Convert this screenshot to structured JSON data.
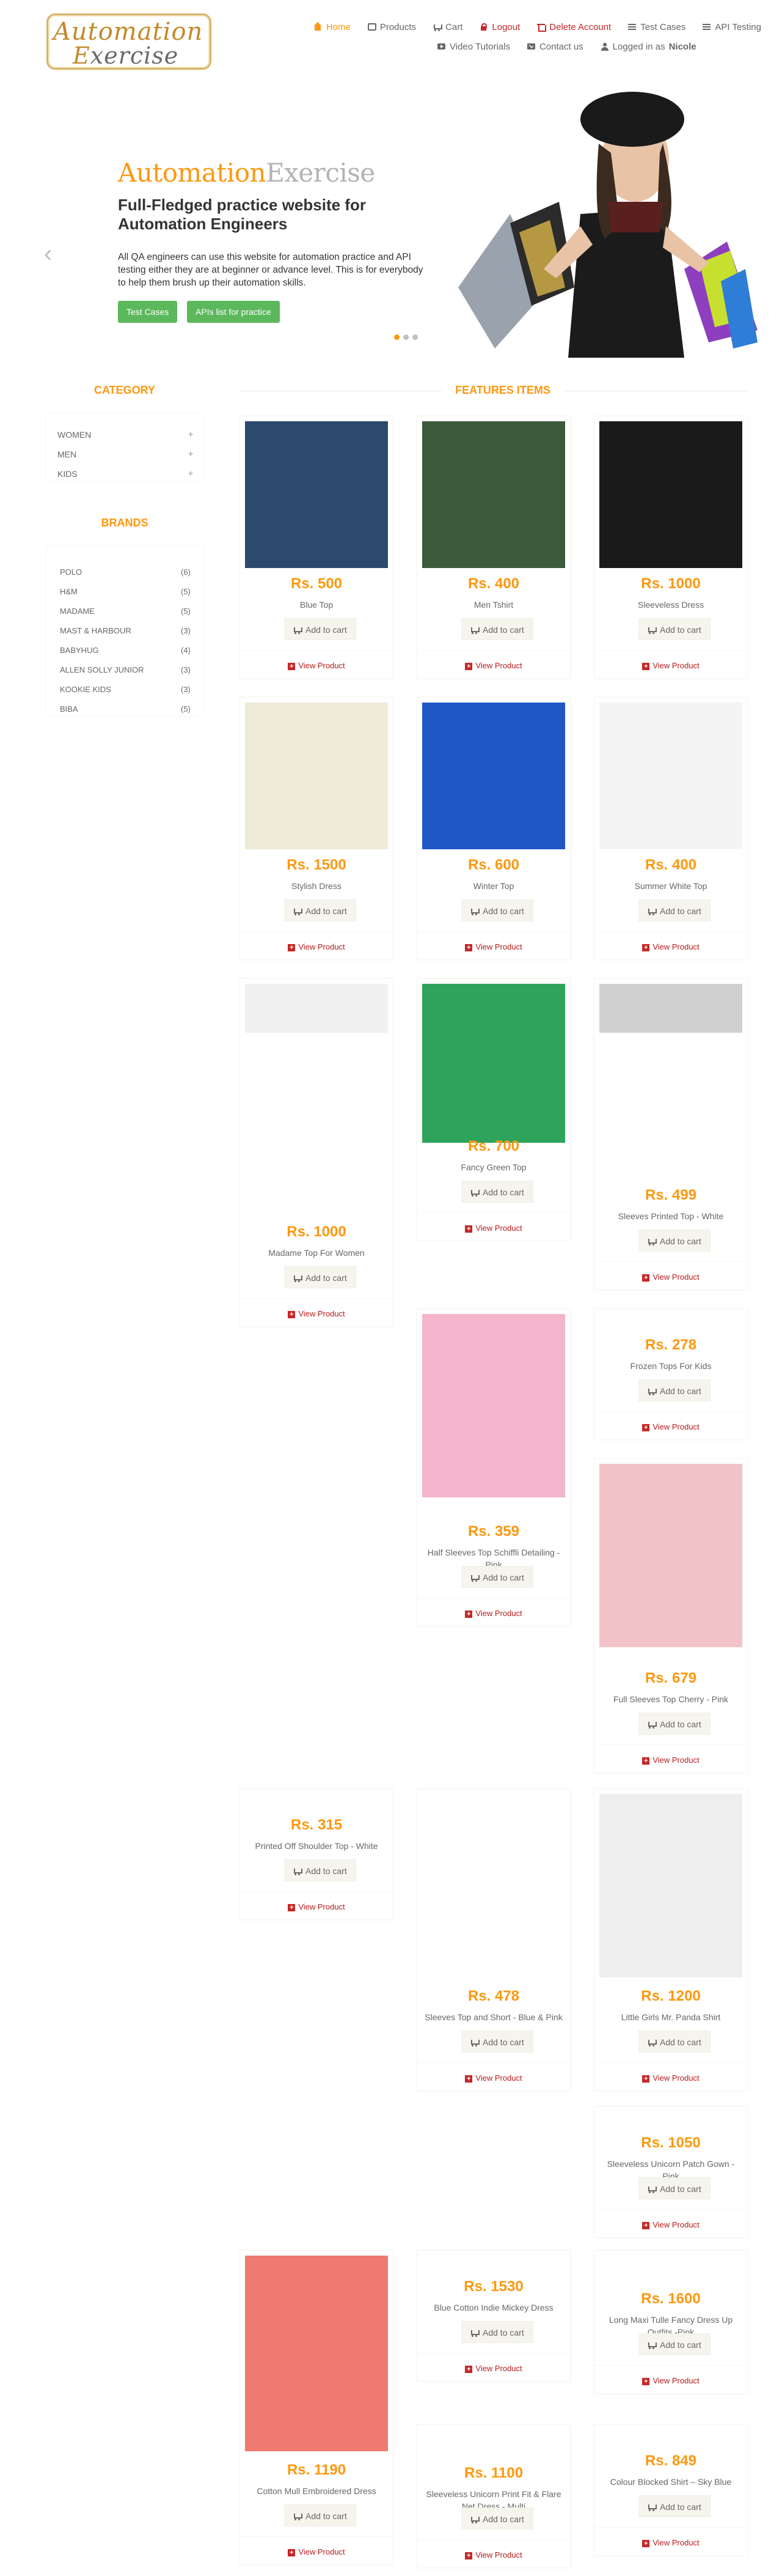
{
  "logo": {
    "line1": "Automation",
    "line2_first": "E",
    "line2_rest": "xercise"
  },
  "nav": {
    "home": "Home",
    "products": "Products",
    "cart": "Cart",
    "logout": "Logout",
    "delete_account": "Delete Account",
    "test_cases": "Test Cases",
    "api_testing": "API Testing",
    "video_tutorials": "Video Tutorials",
    "contact_us": "Contact us",
    "logged_in_prefix": "Logged in as",
    "username": "Nicole"
  },
  "hero": {
    "title_a": "Automation",
    "title_b": "Exercise",
    "subtitle": "Full-Fledged practice website for Automation Engineers",
    "description": "All QA engineers can use this website for automation practice and API testing either they are at beginner or advance level. This is for everybody to help them brush up their automation skills.",
    "btn_test_cases": "Test Cases",
    "btn_apis": "APIs list for practice",
    "prev": "‹",
    "next": "›"
  },
  "category": {
    "title": "Category",
    "items": [
      "Women",
      "Men",
      "Kids"
    ]
  },
  "brands": {
    "title": "Brands",
    "items": [
      {
        "name": "Polo",
        "count": "(6)"
      },
      {
        "name": "H&M",
        "count": "(5)"
      },
      {
        "name": "Madame",
        "count": "(5)"
      },
      {
        "name": "Mast & Harbour",
        "count": "(3)"
      },
      {
        "name": "Babyhug",
        "count": "(4)"
      },
      {
        "name": "Allen Solly Junior",
        "count": "(3)"
      },
      {
        "name": "Kookie Kids",
        "count": "(3)"
      },
      {
        "name": "Biba",
        "count": "(5)"
      }
    ]
  },
  "features": {
    "title": "Features Items",
    "add_to_cart": "Add to cart",
    "view_product": "View Product"
  },
  "products": [
    {
      "price": "Rs. 500",
      "name": "Blue Top"
    },
    {
      "price": "Rs. 400",
      "name": "Men Tshirt"
    },
    {
      "price": "Rs. 1000",
      "name": "Sleeveless Dress"
    },
    {
      "price": "Rs. 1500",
      "name": "Stylish Dress"
    },
    {
      "price": "Rs. 600",
      "name": "Winter Top"
    },
    {
      "price": "Rs. 400",
      "name": "Summer White Top"
    },
    {
      "price": "Rs. 1000",
      "name": "Madame Top For Women"
    },
    {
      "price": "Rs. 700",
      "name": "Fancy Green Top"
    },
    {
      "price": "Rs. 499",
      "name": "Sleeves Printed Top - White"
    },
    {
      "price": "Rs. 359",
      "name": "Half Sleeves Top Schiffli Detailing - Pink"
    },
    {
      "price": "Rs. 278",
      "name": "Frozen Tops For Kids"
    },
    {
      "price": "Rs. 679",
      "name": "Full Sleeves Top Cherry - Pink"
    },
    {
      "price": "Rs. 315",
      "name": "Printed Off Shoulder Top - White"
    },
    {
      "price": "Rs. 478",
      "name": "Sleeves Top and Short - Blue & Pink"
    },
    {
      "price": "Rs. 1200",
      "name": "Little Girls Mr. Panda Shirt"
    },
    {
      "price": "Rs. 1050",
      "name": "Sleeveless Unicorn Patch Gown - Pink"
    },
    {
      "price": "Rs. 1190",
      "name": "Cotton Mull Embroidered Dress"
    },
    {
      "price": "Rs. 1530",
      "name": "Blue Cotton Indie Mickey Dress"
    },
    {
      "price": "Rs. 1600",
      "name": "Long Maxi Tulle Fancy Dress Up Outfits -Pink"
    },
    {
      "price": "Rs. 1100",
      "name": "Sleeveless Unicorn Print Fit & Flare Net Dress - Multi"
    },
    {
      "price": "Rs. 849",
      "name": "Colour Blocked Shirt – Sky Blue"
    }
  ]
}
